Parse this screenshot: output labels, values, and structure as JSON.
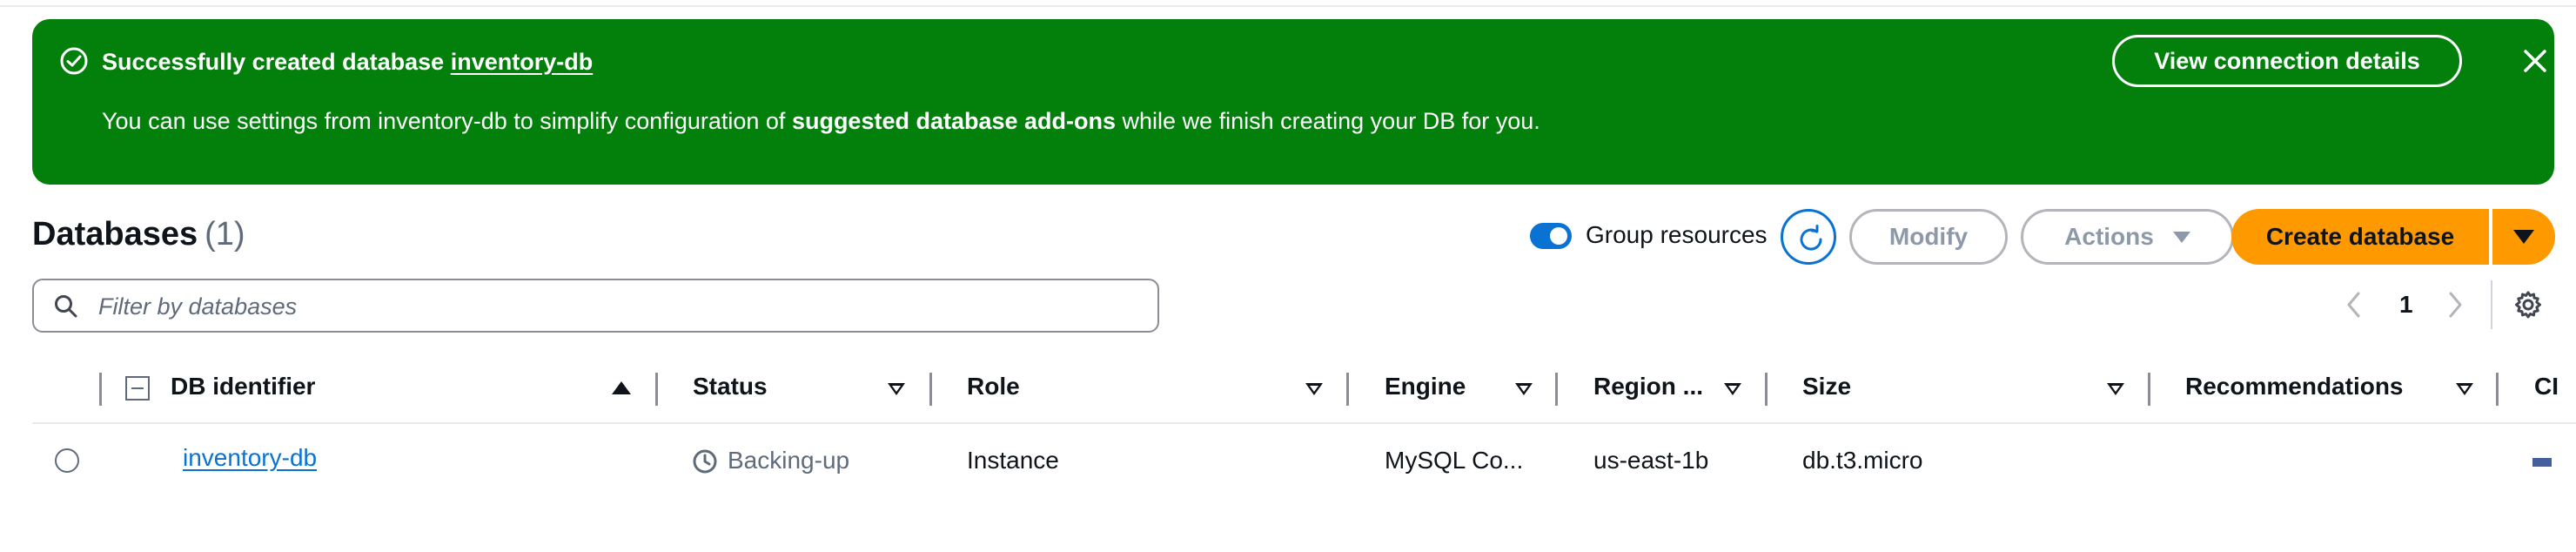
{
  "flash": {
    "title_prefix": "Successfully created database",
    "db_name": "inventory-db",
    "body_start": "You can use settings from inventory-db to simplify configuration of",
    "body_bold": "suggested database add-ons",
    "body_end": "while we finish creating your DB for you.",
    "connection_button": "View connection details",
    "color": "#037f0c"
  },
  "header": {
    "title": "Databases",
    "count": "(1)",
    "group_resources_label": "Group resources",
    "group_resources_on": true,
    "modify_label": "Modify",
    "actions_label": "Actions",
    "create_label": "Create database",
    "accent": "#ff9900",
    "link_color": "#0972d3"
  },
  "filter": {
    "placeholder": "Filter by databases",
    "value": ""
  },
  "pagination": {
    "current_page": "1"
  },
  "table": {
    "columns": [
      "DB identifier",
      "Status",
      "Role",
      "Engine",
      "Region ...",
      "Size",
      "Recommendations",
      "CI"
    ],
    "rows": [
      {
        "db_identifier": "inventory-db",
        "status": "Backing-up",
        "role": "Instance",
        "engine": "MySQL Co...",
        "region": "us-east-1b",
        "size": "db.t3.micro"
      }
    ]
  },
  "icons": {
    "flash_status": "check-circle-icon",
    "flash_close": "close-icon",
    "refresh": "refresh-icon",
    "search": "search-icon",
    "page_prev": "chevron-left-icon",
    "page_next": "chevron-right-icon",
    "preferences": "gear-icon",
    "status": "clock-icon"
  }
}
